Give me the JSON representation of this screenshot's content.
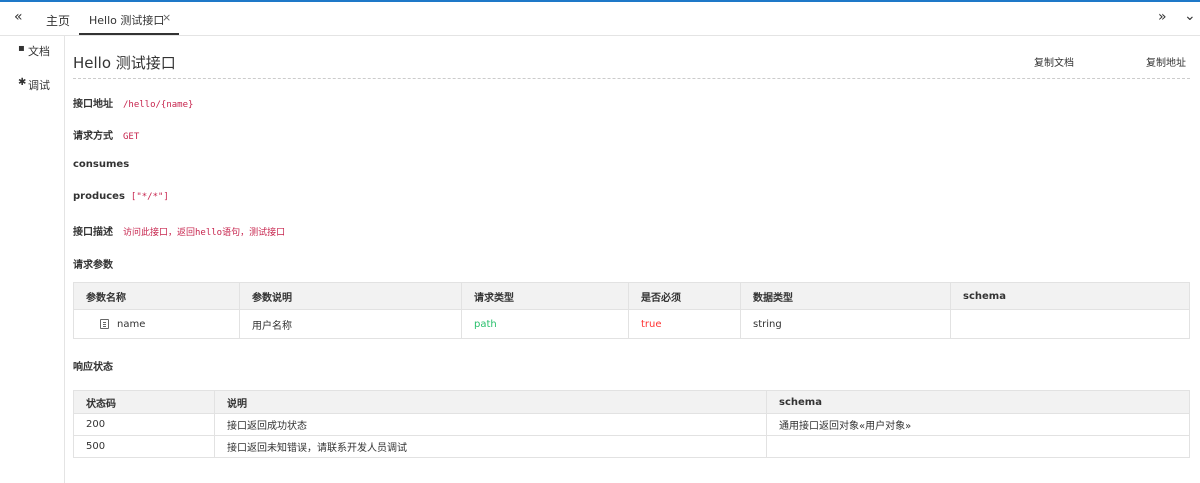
{
  "tabbar": {
    "prev_icon": "«",
    "home_label": "主页",
    "active_tab_label": "Hello 测试接口",
    "close_icon": "×",
    "next_icon": "»",
    "more_icon": "⌄"
  },
  "sidenav": {
    "items": [
      {
        "icon": "doc-icon",
        "glyph": "▪",
        "label": "文档"
      },
      {
        "icon": "bug-icon",
        "glyph": "✱",
        "label": "调试"
      }
    ]
  },
  "doc": {
    "title": "Hello 测试接口",
    "copy_doc": "复制文档",
    "copy_url": "复制地址",
    "fields": {
      "address_key": "接口地址",
      "address_val": "/hello/{name}",
      "method_key": "请求方式",
      "method_val": "GET",
      "consumes_key": "consumes",
      "produces_key": "produces",
      "produces_val": "[\"*/*\"]",
      "desc_key": "接口描述",
      "desc_val": "访问此接口，返回hello语句，测试接口"
    },
    "params_title": "请求参数",
    "params_table": {
      "headers": [
        "参数名称",
        "参数说明",
        "请求类型",
        "是否必须",
        "数据类型",
        "schema"
      ],
      "rows": [
        {
          "name": "name",
          "desc": "用户名称",
          "in": "path",
          "required": "true",
          "type": "string",
          "schema": ""
        }
      ]
    },
    "response_title": "响应状态",
    "response_table": {
      "headers": [
        "状态码",
        "说明",
        "schema"
      ],
      "rows": [
        {
          "code": "200",
          "desc": "接口返回成功状态",
          "schema": "通用接口返回对象«用户对象»"
        },
        {
          "code": "500",
          "desc": "接口返回未知错误，请联系开发人员调试",
          "schema": ""
        }
      ]
    }
  }
}
